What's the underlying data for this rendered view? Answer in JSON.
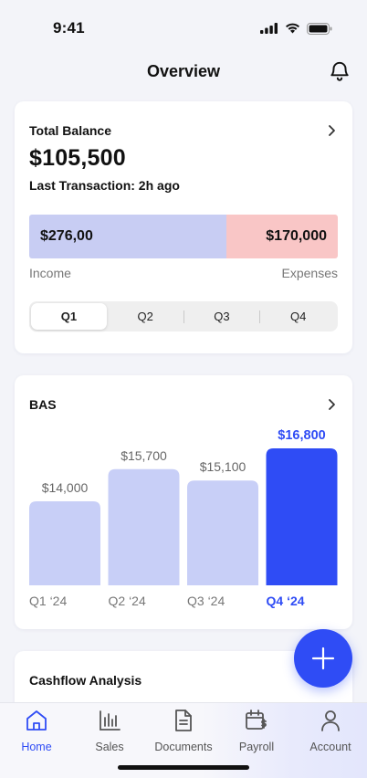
{
  "status": {
    "time": "9:41"
  },
  "header": {
    "title": "Overview"
  },
  "balance": {
    "label": "Total Balance",
    "amount": "$105,500",
    "last_transaction": "Last Transaction: 2h ago",
    "income_value": "$276,00",
    "expenses_value": "$170,000",
    "income_label": "Income",
    "expenses_label": "Expenses",
    "quarters": [
      "Q1",
      "Q2",
      "Q3",
      "Q4"
    ],
    "selected_quarter": "Q1"
  },
  "bas": {
    "title": "BAS"
  },
  "chart_data": {
    "type": "bar",
    "title": "BAS",
    "categories": [
      "Q1 ‘24",
      "Q2 ‘24",
      "Q3 ‘24",
      "Q4 ‘24"
    ],
    "values": [
      14000,
      15700,
      15100,
      16800
    ],
    "value_labels": [
      "$14,000",
      "$15,700",
      "$15,100",
      "$16,800"
    ],
    "highlighted": "Q4 ‘24",
    "colors": {
      "normal": "#c8cff7",
      "highlight": "#2f4cf5"
    }
  },
  "cashflow": {
    "title": "Cashflow Analysis"
  },
  "fab": {
    "icon": "plus-icon"
  },
  "tabs": [
    {
      "label": "Home",
      "icon": "home-icon",
      "active": true
    },
    {
      "label": "Sales",
      "icon": "bar-chart-icon",
      "active": false
    },
    {
      "label": "Documents",
      "icon": "document-icon",
      "active": false
    },
    {
      "label": "Payroll",
      "icon": "payroll-icon",
      "active": false
    },
    {
      "label": "Account",
      "icon": "user-icon",
      "active": false
    }
  ],
  "colors": {
    "accent": "#2f4cf5",
    "income": "#c8cdf3",
    "expenses": "#f9c6c6"
  }
}
